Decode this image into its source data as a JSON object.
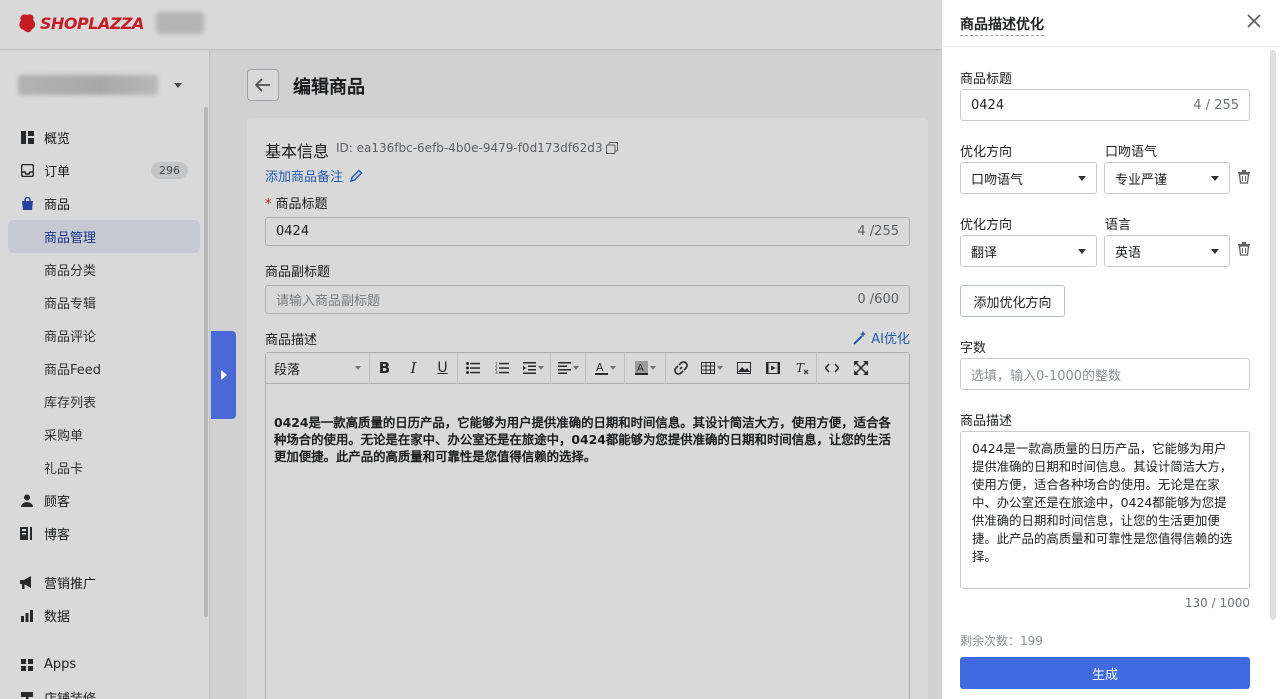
{
  "brand": {
    "name": "SHOPLAZZA",
    "color": "#e8222b"
  },
  "sidebar": {
    "items": [
      {
        "label": "概览",
        "icon": "chart-icon"
      },
      {
        "label": "订单",
        "icon": "inbox-icon",
        "badge": "296"
      },
      {
        "label": "商品",
        "icon": "bag-icon"
      },
      {
        "label": "商品管理",
        "sub": true,
        "active": true
      },
      {
        "label": "商品分类",
        "sub": true
      },
      {
        "label": "商品专辑",
        "sub": true
      },
      {
        "label": "商品评论",
        "sub": true
      },
      {
        "label": "商品Feed",
        "sub": true
      },
      {
        "label": "库存列表",
        "sub": true
      },
      {
        "label": "采购单",
        "sub": true
      },
      {
        "label": "礼品卡",
        "sub": true
      },
      {
        "label": "顾客",
        "icon": "person-icon"
      },
      {
        "label": "博客",
        "icon": "blog-icon"
      },
      {
        "label": "营销推广",
        "icon": "megaphone-icon"
      },
      {
        "label": "数据",
        "icon": "bar-chart-icon"
      },
      {
        "label": "Apps",
        "icon": "apps-icon"
      },
      {
        "label": "店铺装修",
        "icon": "brush-icon"
      }
    ]
  },
  "main": {
    "page_title": "编辑商品",
    "card_title": "基本信息",
    "product_id": "ID: ea136fbc-6efb-4b0e-9479-f0d173df62d3",
    "add_note": "添加商品备注",
    "title_label": "商品标题",
    "title_value": "0424",
    "title_count": "4 /255",
    "subtitle_label": "商品副标题",
    "subtitle_placeholder": "请输入商品副标题",
    "subtitle_count": "0 /600",
    "desc_label": "商品描述",
    "ai_optimize": "AI优化",
    "paragraph_select": "段落",
    "description": "0424是一款高质量的日历产品，它能够为用户提供准确的日期和时间信息。其设计简洁大方，使用方便，适合各种场合的使用。无论是在家中、办公室还是在旅途中，0424都能够为您提供准确的日期和时间信息，让您的生活更加便捷。此产品的高质量和可靠性是您值得信赖的选择。"
  },
  "drawer": {
    "title": "商品描述优化",
    "title_label": "商品标题",
    "title_value": "0424",
    "title_count": "4 / 255",
    "row1": {
      "left_label": "优化方向",
      "left_value": "口吻语气",
      "right_label": "口吻语气",
      "right_value": "专业严谨"
    },
    "row2": {
      "left_label": "优化方向",
      "left_value": "翻译",
      "right_label": "语言",
      "right_value": "英语"
    },
    "add_direction": "添加优化方向",
    "word_count_label": "字数",
    "word_count_placeholder": "选填，输入0-1000的整数",
    "desc_label": "商品描述",
    "desc_value": "0424是一款高质量的日历产品，它能够为用户提供准确的日期和时间信息。其设计简洁大方，使用方便，适合各种场合的使用。无论是在家中、办公室还是在旅途中，0424都能够为您提供准确的日期和时间信息，让您的生活更加便捷。此产品的高质量和可靠性是您值得信赖的选择。",
    "desc_count": "130 / 1000",
    "remaining": "剩余次数：199",
    "generate": "生成"
  }
}
